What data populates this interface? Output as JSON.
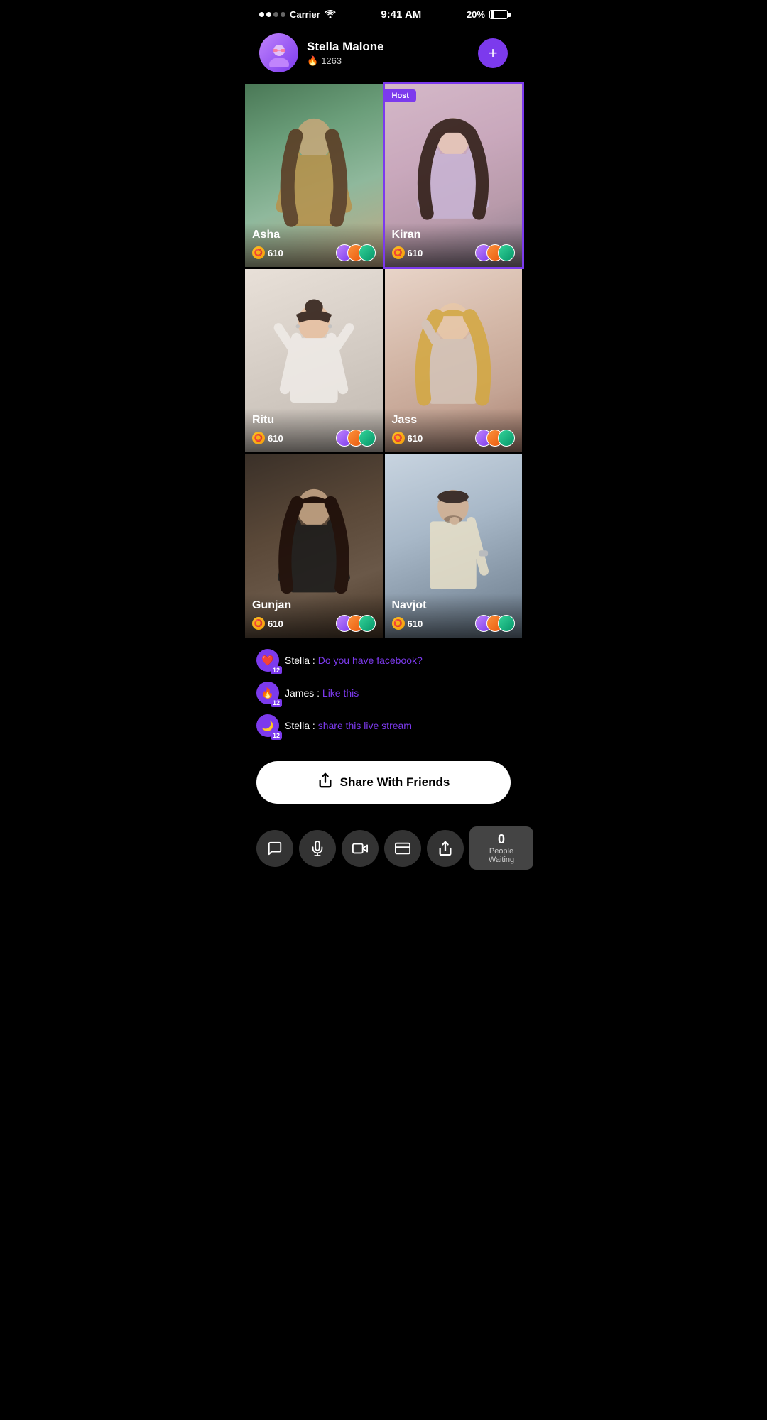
{
  "statusBar": {
    "carrier": "Carrier",
    "time": "9:41 AM",
    "battery": "20%"
  },
  "host": {
    "name": "Stella Malone",
    "score": "1263",
    "followLabel": "+"
  },
  "grid": [
    {
      "id": "asha",
      "name": "Asha",
      "coins": "610",
      "isHost": false,
      "photo": "photo-asha"
    },
    {
      "id": "kiran",
      "name": "Kiran",
      "coins": "610",
      "isHost": true,
      "hostLabel": "Host",
      "photo": "photo-kiran"
    },
    {
      "id": "ritu",
      "name": "Ritu",
      "coins": "610",
      "isHost": false,
      "photo": "photo-ritu"
    },
    {
      "id": "jass",
      "name": "Jass",
      "coins": "610",
      "isHost": false,
      "photo": "photo-jass"
    },
    {
      "id": "gunjan",
      "name": "Gunjan",
      "coins": "610",
      "isHost": false,
      "photo": "photo-gunjan"
    },
    {
      "id": "navjot",
      "name": "Navjot",
      "coins": "610",
      "isHost": false,
      "photo": "photo-navjot"
    }
  ],
  "chat": [
    {
      "id": "msg1",
      "user": "Stella",
      "separator": " : ",
      "text": "Do you have facebook?",
      "badge": "❤",
      "level": "12"
    },
    {
      "id": "msg2",
      "user": "James",
      "separator": " : ",
      "text": "Like this",
      "badge": "🔥",
      "level": "12"
    },
    {
      "id": "msg3",
      "user": "Stella",
      "separator": " : ",
      "text": "share this live stream",
      "badge": "🌙",
      "level": "12"
    }
  ],
  "shareButton": {
    "label": "Share With Friends"
  },
  "bottomBar": {
    "buttons": [
      {
        "id": "chat",
        "icon": "💬"
      },
      {
        "id": "mic",
        "icon": "🎙"
      },
      {
        "id": "video",
        "icon": "🎥"
      },
      {
        "id": "wallet",
        "icon": "👛"
      },
      {
        "id": "share",
        "icon": "↗"
      }
    ],
    "peopleWaiting": {
      "count": "0",
      "label": "People Waiting"
    }
  }
}
